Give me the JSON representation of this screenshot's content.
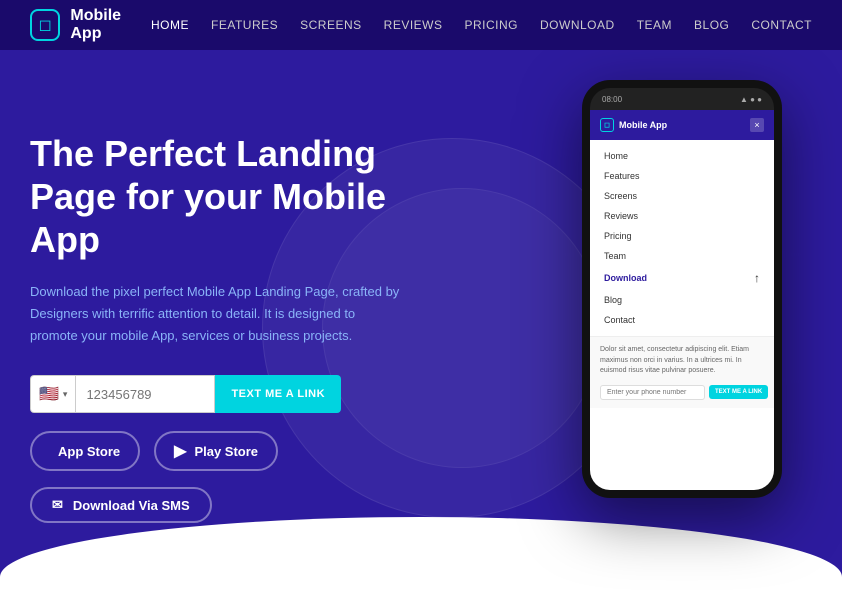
{
  "nav": {
    "logo_text": "Mobile App",
    "logo_icon": "📱",
    "links": [
      {
        "label": "HOME",
        "active": true
      },
      {
        "label": "FEATURES",
        "active": false
      },
      {
        "label": "SCREENS",
        "active": false
      },
      {
        "label": "REVIEWS",
        "active": false
      },
      {
        "label": "PRICING",
        "active": false
      },
      {
        "label": "DOWNLOAD",
        "active": false
      },
      {
        "label": "TEAM",
        "active": false
      },
      {
        "label": "BLOG",
        "active": false
      },
      {
        "label": "CONTACT",
        "active": false
      }
    ]
  },
  "hero": {
    "title": "The Perfect Landing Page for your Mobile App",
    "description": "Download the pixel perfect Mobile App Landing Page, crafted by Designers with terrific attention to detail. It is designed to promote your mobile App, services or business projects.",
    "phone_placeholder": "123456789",
    "sms_button_label": "TEXT ME A LINK",
    "app_store_label": "App Store",
    "play_store_label": "Play Store",
    "download_sms_label": "Download Via SMS"
  },
  "phone_mockup": {
    "status_time": "08:00",
    "logo_text": "Mobile App",
    "close_btn": "×",
    "menu_items": [
      {
        "label": "Home",
        "active": false
      },
      {
        "label": "Features",
        "active": false
      },
      {
        "label": "Screens",
        "active": false
      },
      {
        "label": "Reviews",
        "active": false
      },
      {
        "label": "Pricing",
        "active": false
      },
      {
        "label": "Team",
        "active": false
      },
      {
        "label": "Download",
        "active": true
      },
      {
        "label": "Blog",
        "active": false
      },
      {
        "label": "Contact",
        "active": false
      }
    ],
    "bottom_text": "Dolor sit amet, consectetur adipiscing elit. Etiam maximus non orci in varius. In a ultrices mi. In euismod risus vitae pulvinar posuere.",
    "input_placeholder": "Enter your phone number",
    "sms_btn_label": "TEXT ME A LINK"
  }
}
